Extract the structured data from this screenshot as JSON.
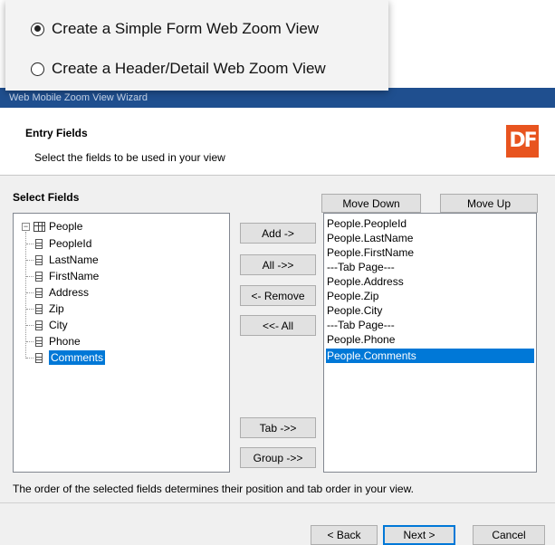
{
  "popup": {
    "options": [
      {
        "label": "Create a Simple Form Web Zoom View",
        "checked": true
      },
      {
        "label": "Create a Header/Detail Web Zoom View",
        "checked": false
      }
    ]
  },
  "window": {
    "title": "Web Mobile Zoom View Wizard"
  },
  "header": {
    "title": "Entry Fields",
    "subtitle": "Select the fields to be used in your view",
    "logo_text": "DF",
    "logo_color": "#e8541f"
  },
  "select_fields": {
    "label": "Select Fields",
    "root": "People",
    "root_expander": "−",
    "fields": [
      "PeopleId",
      "LastName",
      "FirstName",
      "Address",
      "Zip",
      "City",
      "Phone",
      "Comments"
    ],
    "selected": "Comments"
  },
  "buttons": {
    "add": "Add ->",
    "all": "All ->>",
    "remove": "<- Remove",
    "remove_all": "<<- All",
    "tab": "Tab ->>",
    "group": "Group ->>",
    "move_down": "Move Down",
    "move_up": "Move Up"
  },
  "selected_list": {
    "items": [
      "People.PeopleId",
      "People.LastName",
      "People.FirstName",
      "---Tab Page---",
      "People.Address",
      "People.Zip",
      "People.City",
      "---Tab Page---",
      "People.Phone",
      "People.Comments"
    ],
    "selected_index": 9
  },
  "footer": {
    "note": "The order of the selected fields determines their position and tab order in your view.",
    "back": "< Back",
    "next": "Next >",
    "cancel": "Cancel"
  },
  "colors": {
    "accent": "#0078d7",
    "titlebar": "#1f4f8f"
  }
}
